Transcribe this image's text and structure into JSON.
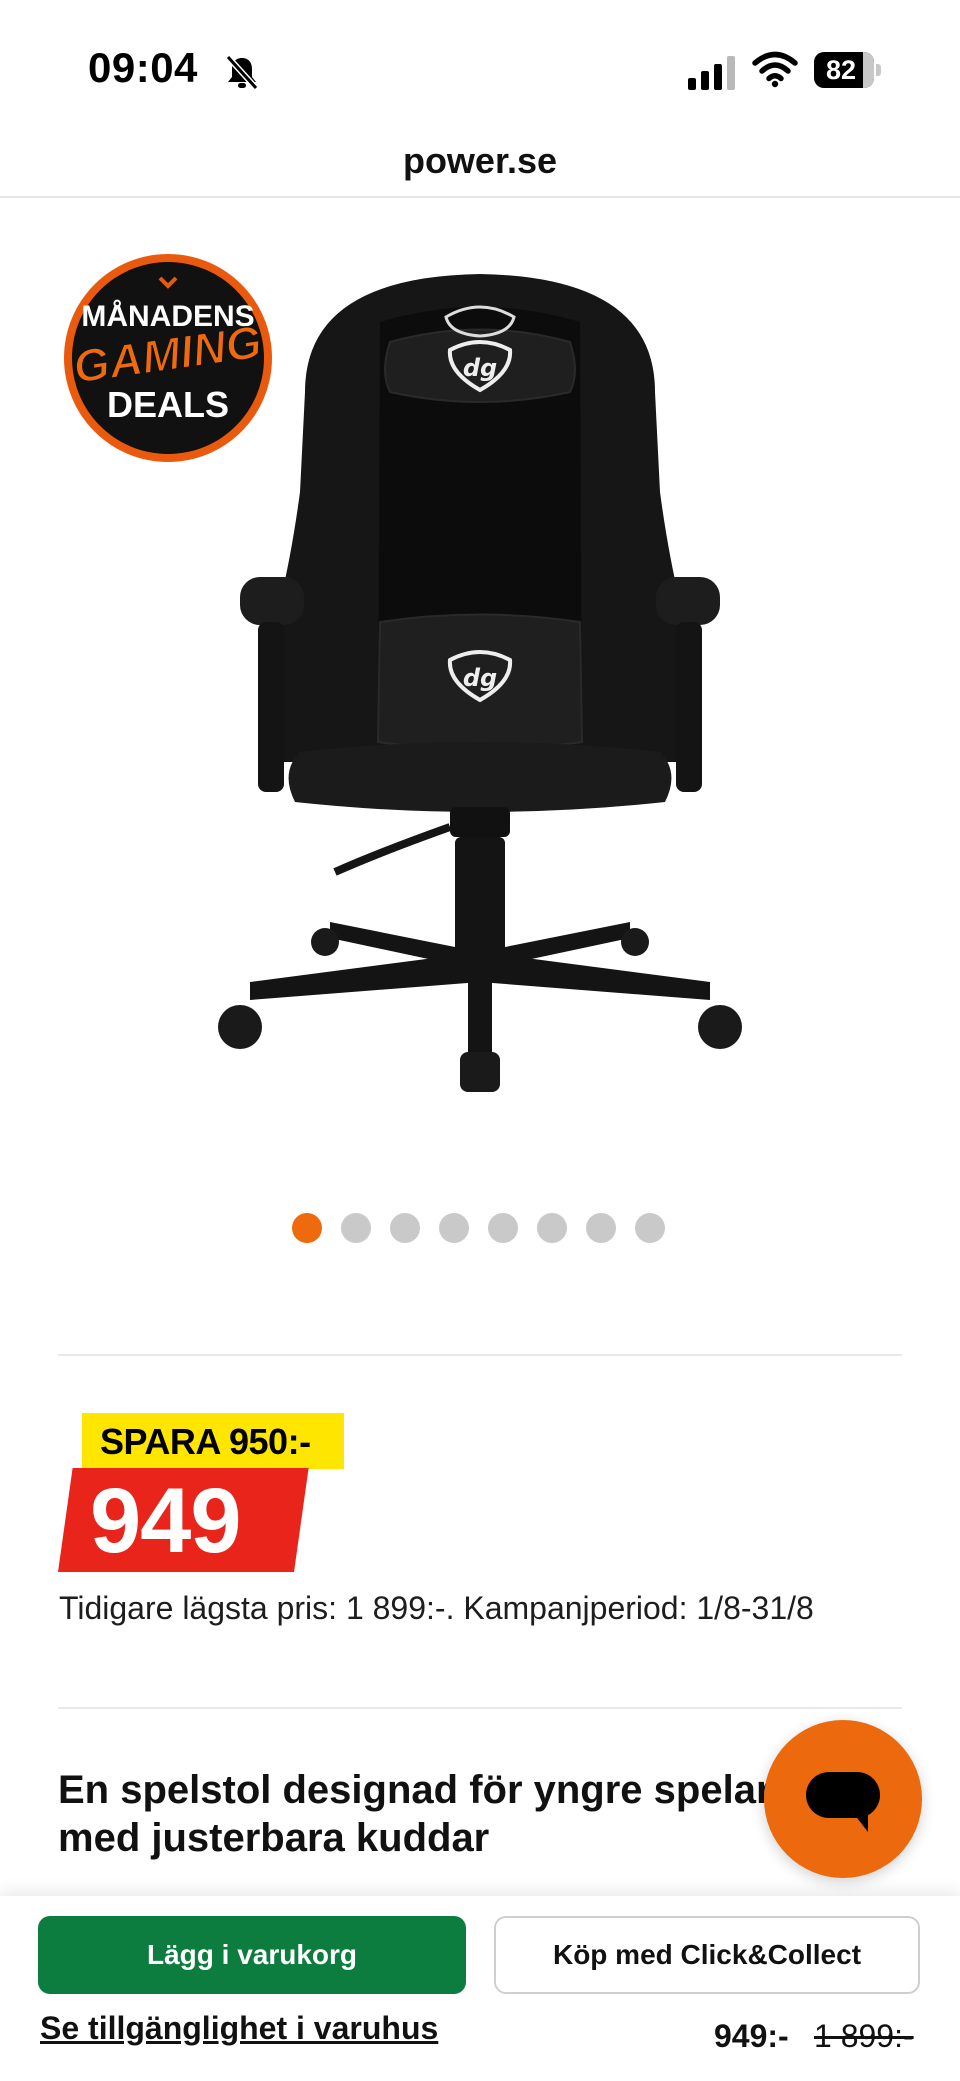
{
  "status_bar": {
    "time": "09:04",
    "battery": "82",
    "battery_level": 0.82
  },
  "browser": {
    "url": "power.se"
  },
  "product": {
    "image_alt": "Gaming chair",
    "badge": {
      "line1": "MÅNADENS",
      "line2": "GAMING",
      "line3": "DEALS"
    },
    "chair_logo": "dg",
    "carousel": {
      "total": 8,
      "active_index": 0
    },
    "savings_label": "SPARA 950:-",
    "price": "949",
    "price_info": "Tidigare lägsta pris: 1 899:-. Kampanjperiod: 1/8-31/8",
    "headline": "En spelstol designad för yngre spelare med justerbara kuddar"
  },
  "bottom_bar": {
    "add_to_cart": "Lägg i varukorg",
    "click_collect": "Köp med Click&Collect",
    "store_availability": "Se tillgänglighet i varuhus",
    "price": "949:-",
    "old_price": "1 899:-"
  },
  "colors": {
    "accent_orange": "#ee6a0d",
    "price_red": "#e9241b",
    "savings_yellow": "#ffe600",
    "cart_green": "#0d7c3f"
  },
  "icons": {
    "mute": "bell-slash-icon",
    "signal": "cellular-signal-icon",
    "wifi": "wifi-icon",
    "chat": "chat-bubble-icon"
  }
}
